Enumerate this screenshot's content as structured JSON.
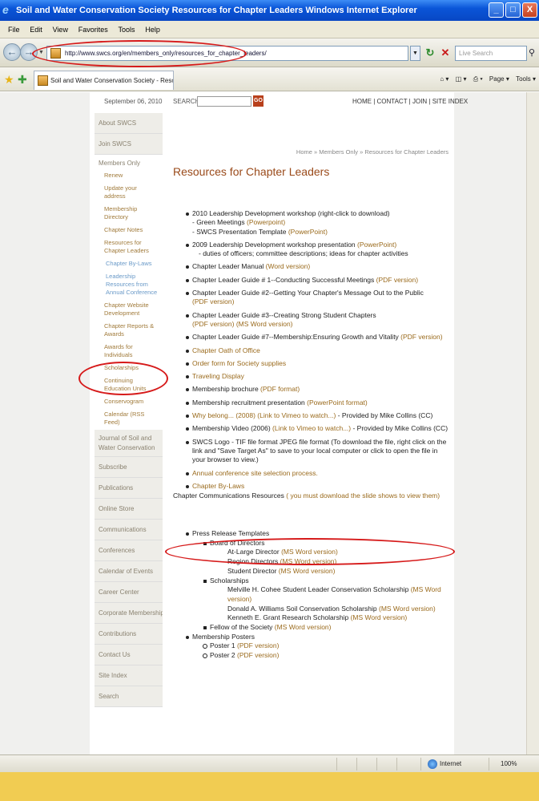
{
  "window": {
    "title": "Soil and Water Conservation Society   Resources for Chapter Leaders   Windows Internet Explorer",
    "buttons": {
      "minimize": "_",
      "maximize": "□",
      "close": "X"
    }
  },
  "menu": [
    "File",
    "Edit",
    "View",
    "Favorites",
    "Tools",
    "Help"
  ],
  "address": {
    "url": "http://www.swcs.org/en/members_only/resources_for_chapter_leaders/",
    "search_placeholder": "Live Search"
  },
  "tabs": {
    "active": "Soil and Water Conservation Society - Resources for ...",
    "tools": [
      "Page ▾",
      "Tools ▾"
    ]
  },
  "page_header": {
    "date": "September 06, 2010",
    "search_label": "SEARCH",
    "go": "GO",
    "top_links": "HOME  |  CONTACT  |  JOIN  |  SITE INDEX"
  },
  "sidebar": {
    "about": "About SWCS",
    "join": "Join SWCS",
    "members_only": "Members Only",
    "sub": [
      "Renew",
      "Update your address",
      "Membership Directory",
      "Chapter Notes"
    ],
    "current": "Resources for Chapter Leaders",
    "current_sub": [
      "Chapter By-Laws",
      "Leadership Resources from Annual Conference"
    ],
    "sub2": [
      "Chapter Website Development",
      "Chapter Reports & Awards",
      "Awards for Individuals",
      "Scholarships",
      "Continuing Education Units",
      "Conservogram",
      "Calendar (RSS Feed)"
    ],
    "main": [
      "Journal of Soil and Water Conservation",
      "Subscribe",
      "Publications",
      "Online Store",
      "Communications",
      "Conferences",
      "Calendar of Events",
      "Career Center",
      "Corporate Membership",
      "Contributions",
      "Contact Us",
      "Site Index",
      "Search"
    ]
  },
  "breadcrumb": "Home » Members Only » Resources for Chapter Leaders",
  "page_title": "Resources for Chapter Leaders",
  "resources": {
    "r1": "2010 Leadership Development workshop (right-click to download)",
    "r1a_text": "- Green Meetings ",
    "r1a_link": "(Powerpoint)",
    "r1b_text": "- SWCS Presentation Template ",
    "r1b_link": "(PowerPoint)",
    "r2_text": "2009 Leadership Development workshop  presentation ",
    "r2_link": "(PowerPoint)",
    "r2a": "- duties of officers; committee descriptions; ideas for chapter activities",
    "r3_text": "Chapter Leader Manual ",
    "r3_link": "(Word version)",
    "r4_text": "Chapter Leader Guide # 1--Conducting Successful Meetings ",
    "r4_link": "(PDF version)",
    "r5_text": "Chapter Leader Guide #2--Getting Your Chapter's Message Out to the Public",
    "r5_link": "(PDF version)",
    "r6_text": "Chapter Leader Guide #3--Creating Strong Student Chapters",
    "r6_link1": "(PDF version)",
    "r6_link2": "(MS Word version)",
    "r7_text": "Chapter Leader Guide #7--Membership:Ensuring Growth and Vitality ",
    "r7_link": "(PDF version)",
    "r8": "Chapter Oath of Office",
    "r9": "Order form for Society supplies",
    "r10": "Traveling Display",
    "r11_text": "Membership brochure ",
    "r11_link": "(PDF format)",
    "r12_text": "Membership recruitment presentation ",
    "r12_link": "(PowerPoint format)",
    "r13_text": "Why belong... (2008) ",
    "r13_link": "(Link to Vimeo to watch...)",
    "r13_tail": " - Provided by Mike Collins (CC)",
    "r14_text": "Membership Video (2006) ",
    "r14_link": "(Link to Vimeo to watch...)",
    "r14_tail": " - Provided by Mike Collins (CC)",
    "r15_text": "SWCS Logo - ",
    "r15_link1": "TIF file format",
    "r15_link2": "JPEG file format",
    "r15_tail": " (To download the file, right click on the link and \"Save Target As\" to save to your local computer or click to open the file  in your browser to view.)",
    "r16": "Annual conference site selection process.",
    "r17": "Chapter By-Laws"
  },
  "communications": {
    "heading": "Chapter Communications Resources ",
    "note": "( you must download the slide shows to view them)",
    "press": "Press Release Templates",
    "board": "Board of Directors",
    "al_text": "At-Large Director ",
    "region_text": "Region Directors ",
    "student_text": "Student Director ",
    "scholarships": "Scholarships",
    "s1_text": "Melville H. Cohee Student Leader Conservation Scholarship ",
    "s2_text": "Donald A. Williams Soil Conservation Scholarship ",
    "s3_text": "Kenneth E. Grant Research Scholarship ",
    "fellow_text": "Fellow of the Society ",
    "word_link": "(MS Word version)",
    "posters": "Membership Posters",
    "p1_text": "Poster 1 ",
    "p2_text": "Poster 2 ",
    "pdf_link": "(PDF version)"
  },
  "status": {
    "zone": "Internet",
    "zoom": "100%"
  },
  "colors": {
    "titlebar": "#0a55d8",
    "link": "#9a6a1c",
    "heading": "#9a4a1a",
    "highlight": "#d61a1a",
    "desktop": "#f1cc52"
  }
}
